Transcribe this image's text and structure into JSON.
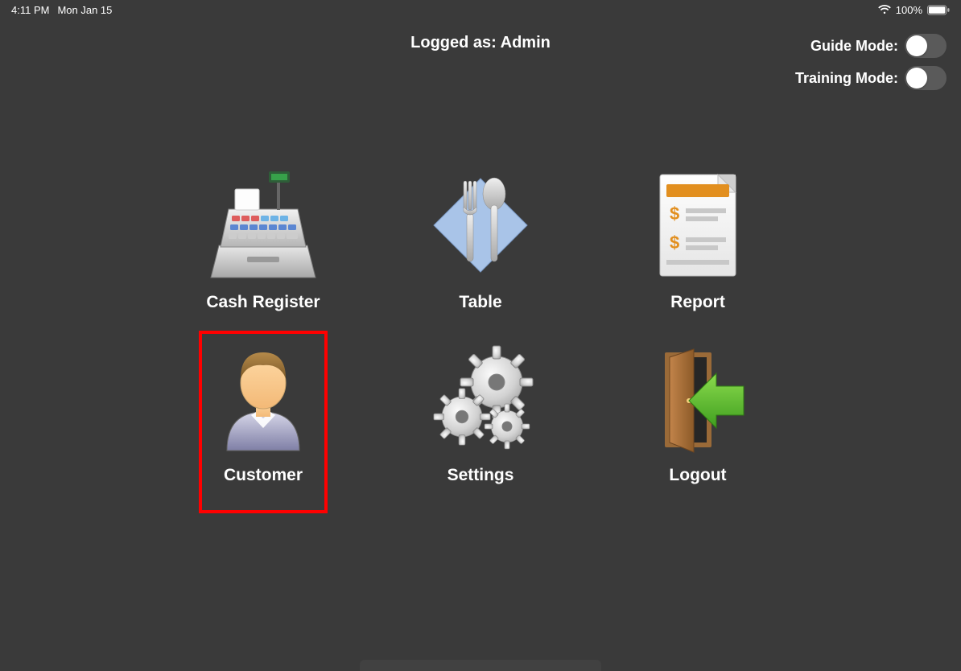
{
  "status_bar": {
    "time": "4:11 PM",
    "date": "Mon Jan 15",
    "battery_percent": "100%"
  },
  "header": {
    "logged_as": "Logged as: Admin"
  },
  "toggles": {
    "guide_mode_label": "Guide Mode:",
    "training_mode_label": "Training Mode:",
    "guide_mode_on": false,
    "training_mode_on": false
  },
  "menu": {
    "items": [
      {
        "label": "Cash Register",
        "highlighted": false
      },
      {
        "label": "Table",
        "highlighted": false
      },
      {
        "label": "Report",
        "highlighted": false
      },
      {
        "label": "Customer",
        "highlighted": true
      },
      {
        "label": "Settings",
        "highlighted": false
      },
      {
        "label": "Logout",
        "highlighted": false
      }
    ]
  }
}
